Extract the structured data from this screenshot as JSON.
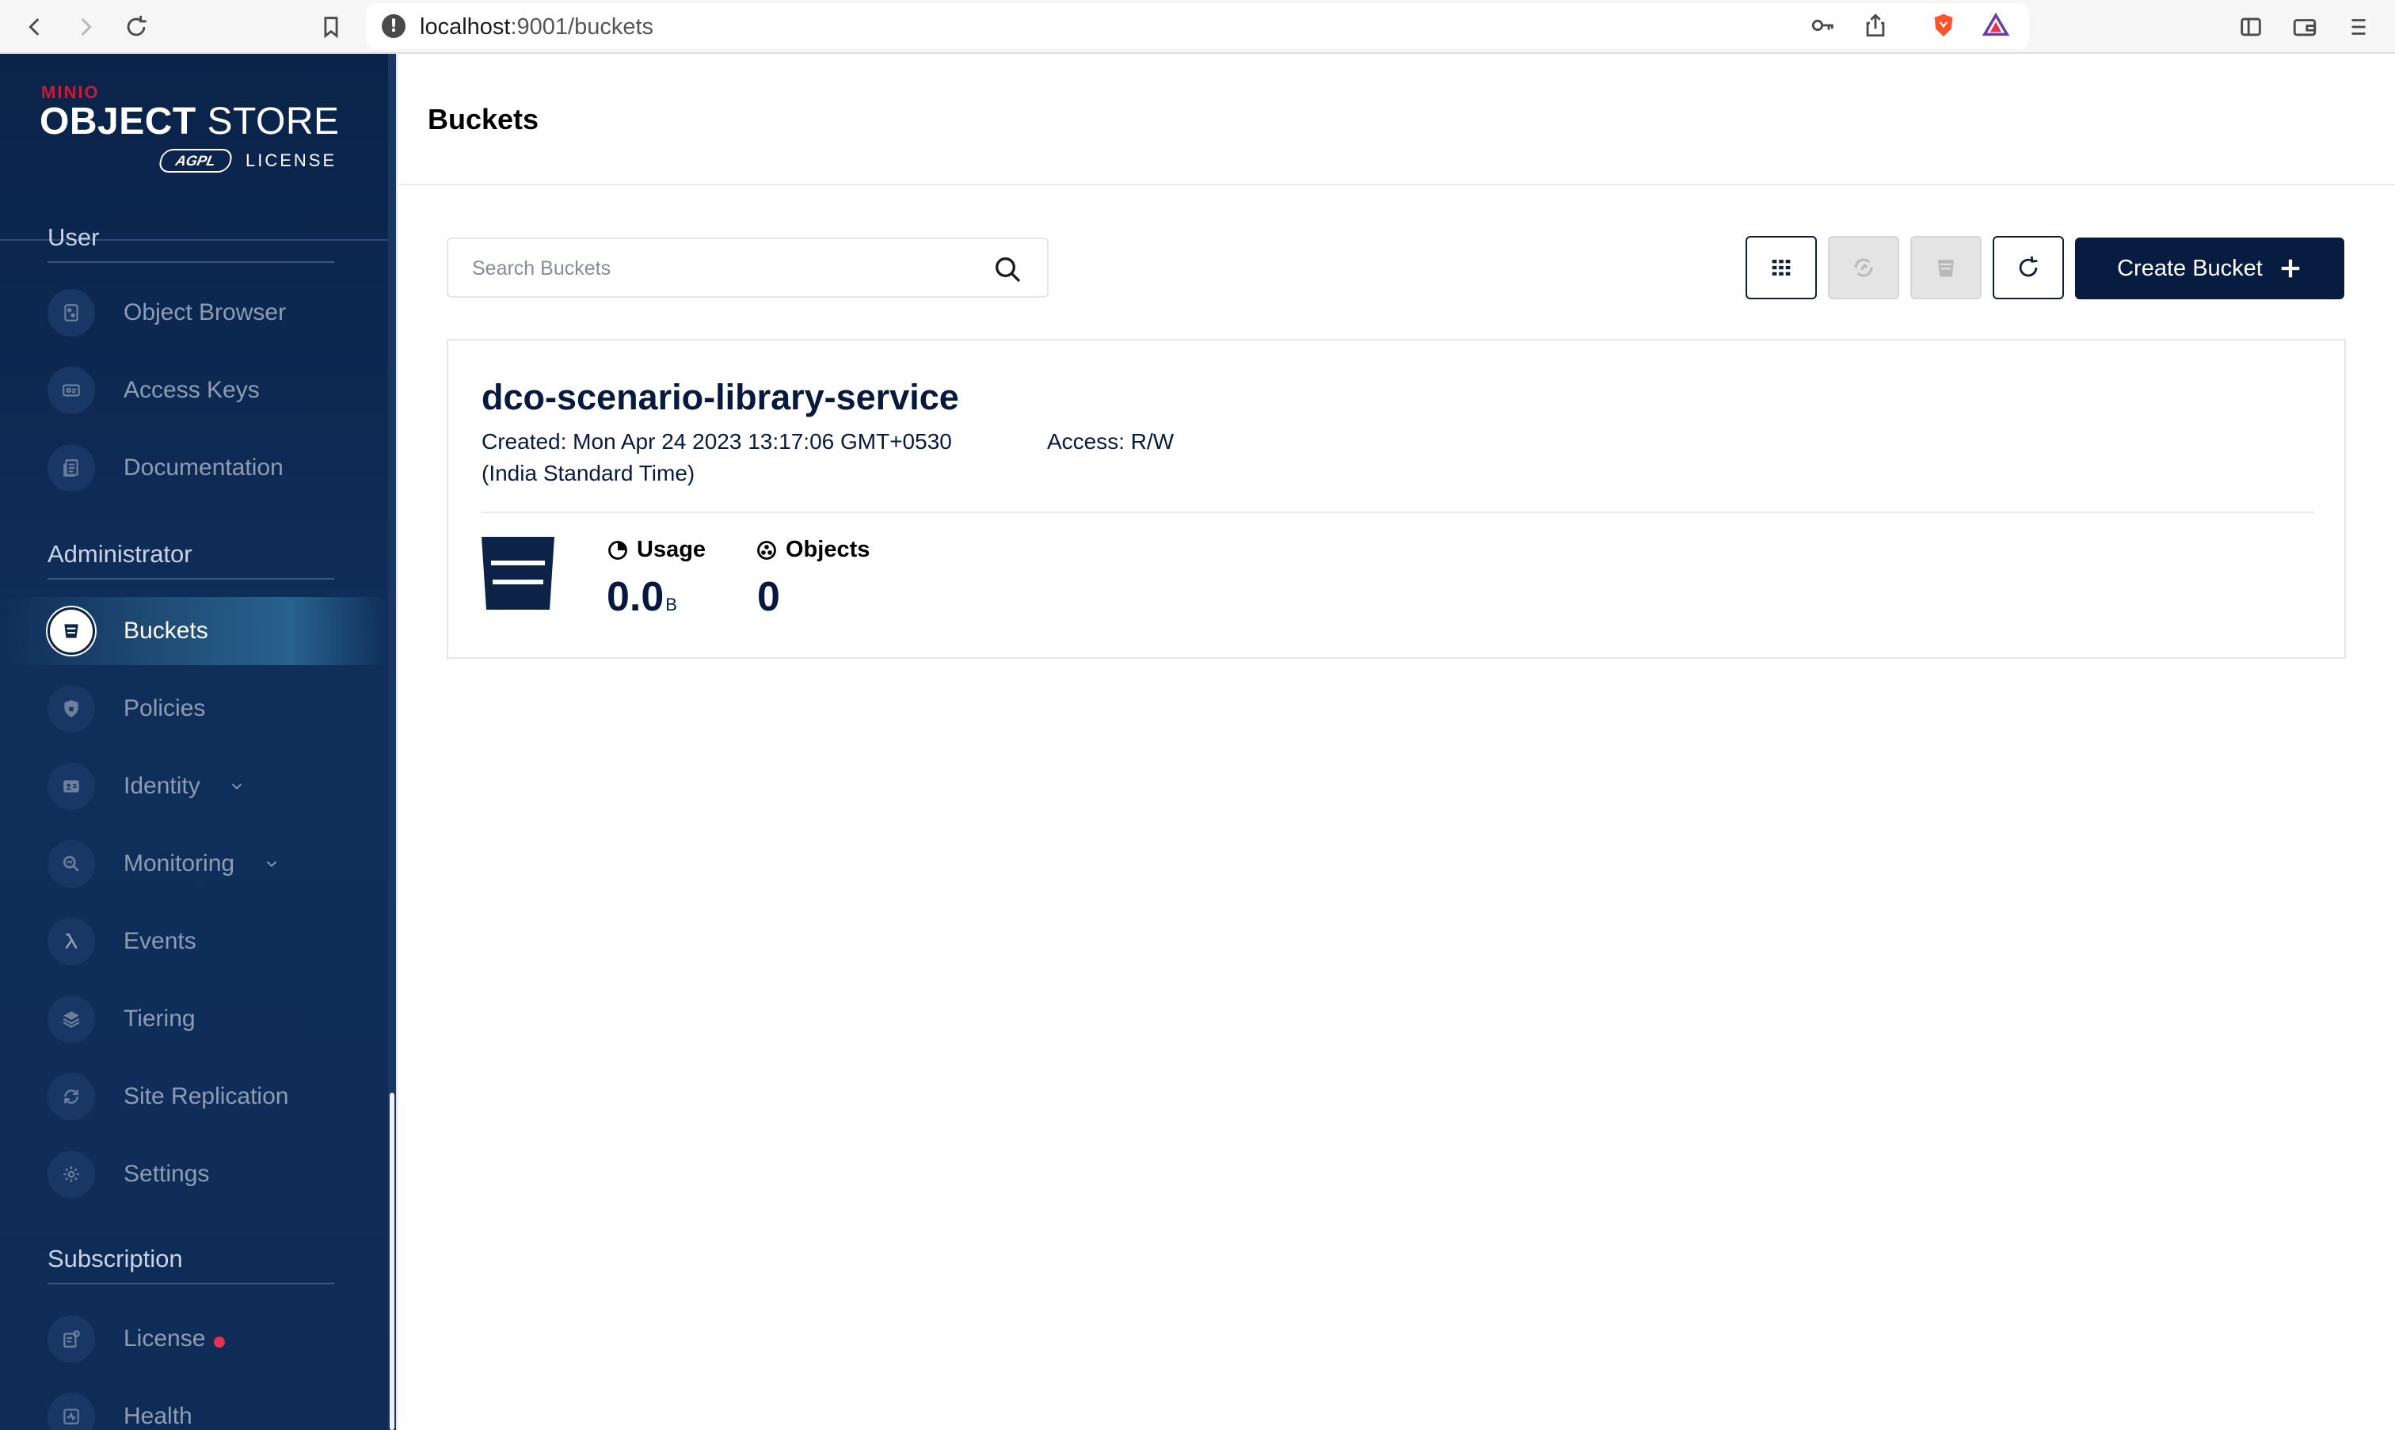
{
  "browser": {
    "url_host": "localhost",
    "url_rest": ":9001/buckets"
  },
  "sidebar": {
    "logo": {
      "brand": "MINIO",
      "product_bold": "OBJECT",
      "product_rest": " STORE",
      "badge": "AGPL",
      "license": "LICENSE"
    },
    "sections": {
      "user": "User",
      "administrator": "Administrator",
      "subscription": "Subscription"
    },
    "items": {
      "object_browser": "Object Browser",
      "access_keys": "Access Keys",
      "documentation": "Documentation",
      "buckets": "Buckets",
      "policies": "Policies",
      "identity": "Identity",
      "monitoring": "Monitoring",
      "events": "Events",
      "tiering": "Tiering",
      "site_replication": "Site Replication",
      "settings": "Settings",
      "license": "License",
      "health": "Health"
    },
    "active_item": "Buckets"
  },
  "header": {
    "title": "Buckets"
  },
  "search": {
    "placeholder": "Search Buckets",
    "value": ""
  },
  "toolbar": {
    "create_bucket_label": "Create Bucket"
  },
  "bucket": {
    "name": "dco-scenario-library-service",
    "created": "Created: Mon Apr 24 2023 13:17:06 GMT+0530 (India Standard Time)",
    "access": "Access: R/W",
    "usage_label": "Usage",
    "usage_value": "0.0",
    "usage_unit": "B",
    "objects_label": "Objects",
    "objects_value": "0"
  },
  "colors": {
    "sidebar_bg": "#0f2e5a",
    "primary": "#081c42",
    "license_dot": "#e0334f"
  }
}
